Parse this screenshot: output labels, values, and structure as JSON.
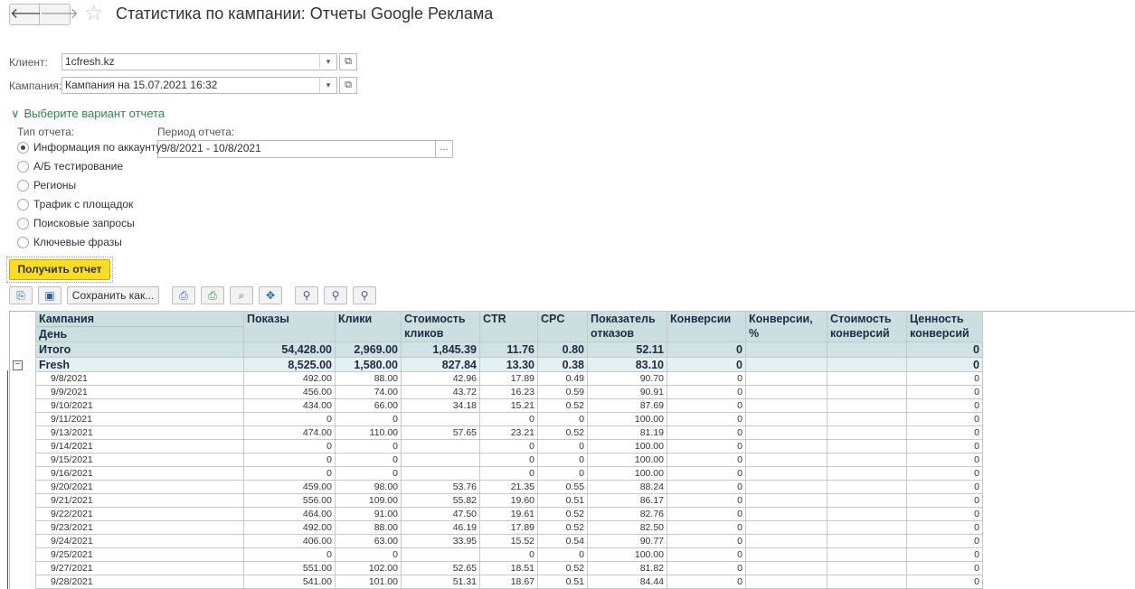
{
  "window": {
    "title": "Статистика по кампании: Отчеты Google Реклама",
    "back_glyph": "🡐",
    "forward_glyph": "🡒",
    "star_glyph": "☆"
  },
  "form": {
    "client_label": "Клиент:",
    "client_value": "1cfresh.kz",
    "campaign_label": "Кампания:",
    "campaign_value": "Кампания на 15.07.2021 16:32",
    "dropdown_glyph": "▾",
    "open_glyph": "⧉"
  },
  "report_group": {
    "title": "Выберите вариант отчета",
    "chevron": "∨",
    "type_label": "Тип отчета:",
    "period_label": "Период отчета:",
    "period_value": "9/8/2021 - 10/8/2021",
    "period_btn": "...",
    "options": [
      {
        "label": "Информация по аккаунту",
        "selected": true
      },
      {
        "label": "А/Б тестирование",
        "selected": false
      },
      {
        "label": "Регионы",
        "selected": false
      },
      {
        "label": "Трафик с площадок",
        "selected": false
      },
      {
        "label": "Поисковые запросы",
        "selected": false
      },
      {
        "label": "Ключевые фразы",
        "selected": false
      }
    ]
  },
  "get_report_label": "Получить отчет",
  "toolbar": {
    "save_as_label": "Сохранить как...",
    "icons": [
      "copy-icon",
      "save-icon",
      "print-icon",
      "print-preview-icon",
      "preview-icon",
      "move-icon",
      "search-icon",
      "find-next-icon",
      "find-prev-icon"
    ]
  },
  "table": {
    "headers": [
      {
        "top": "Кампания",
        "bottom": "День"
      },
      {
        "top": "Показы",
        "bottom": ""
      },
      {
        "top": "Клики",
        "bottom": ""
      },
      {
        "top": "Стоимость",
        "bottom": "кликов"
      },
      {
        "top": "CTR",
        "bottom": ""
      },
      {
        "top": "CPC",
        "bottom": ""
      },
      {
        "top": "Показатель",
        "bottom": "отказов"
      },
      {
        "top": "Конверсии",
        "bottom": ""
      },
      {
        "top": "Конверсии,",
        "bottom": "%"
      },
      {
        "top": "Стоимость",
        "bottom": "конверсий"
      },
      {
        "top": "Ценность",
        "bottom": "конверсий"
      }
    ],
    "total": [
      "Итого",
      "54,428.00",
      "2,969.00",
      "1,845.39",
      "11.76",
      "0.80",
      "52.11",
      "0",
      "",
      "",
      "0"
    ],
    "group": [
      "Fresh",
      "8,525.00",
      "1,580.00",
      "827.84",
      "13.30",
      "0.38",
      "83.10",
      "0",
      "",
      "",
      "0"
    ],
    "rows": [
      [
        "9/8/2021",
        "492.00",
        "88.00",
        "42.96",
        "17.89",
        "0.49",
        "90.70",
        "0",
        "",
        "",
        "0"
      ],
      [
        "9/9/2021",
        "456.00",
        "74.00",
        "43.72",
        "16.23",
        "0.59",
        "90.91",
        "0",
        "",
        "",
        "0"
      ],
      [
        "9/10/2021",
        "434.00",
        "66.00",
        "34.18",
        "15.21",
        "0.52",
        "87.69",
        "0",
        "",
        "",
        "0"
      ],
      [
        "9/11/2021",
        "0",
        "0",
        "",
        "0",
        "0",
        "100.00",
        "0",
        "",
        "",
        "0"
      ],
      [
        "9/13/2021",
        "474.00",
        "110.00",
        "57.65",
        "23.21",
        "0.52",
        "81.19",
        "0",
        "",
        "",
        "0"
      ],
      [
        "9/14/2021",
        "0",
        "0",
        "",
        "0",
        "0",
        "100.00",
        "0",
        "",
        "",
        "0"
      ],
      [
        "9/15/2021",
        "0",
        "0",
        "",
        "0",
        "0",
        "100.00",
        "0",
        "",
        "",
        "0"
      ],
      [
        "9/16/2021",
        "0",
        "0",
        "",
        "0",
        "0",
        "100.00",
        "0",
        "",
        "",
        "0"
      ],
      [
        "9/20/2021",
        "459.00",
        "98.00",
        "53.76",
        "21.35",
        "0.55",
        "88.24",
        "0",
        "",
        "",
        "0"
      ],
      [
        "9/21/2021",
        "556.00",
        "109.00",
        "55.82",
        "19.60",
        "0.51",
        "86.17",
        "0",
        "",
        "",
        "0"
      ],
      [
        "9/22/2021",
        "464.00",
        "91.00",
        "47.50",
        "19.61",
        "0.52",
        "82.76",
        "0",
        "",
        "",
        "0"
      ],
      [
        "9/23/2021",
        "492.00",
        "88.00",
        "46.19",
        "17.89",
        "0.52",
        "82.50",
        "0",
        "",
        "",
        "0"
      ],
      [
        "9/24/2021",
        "406.00",
        "63.00",
        "33.95",
        "15.52",
        "0.54",
        "90.77",
        "0",
        "",
        "",
        "0"
      ],
      [
        "9/25/2021",
        "0",
        "0",
        "",
        "0",
        "0",
        "100.00",
        "0",
        "",
        "",
        "0"
      ],
      [
        "9/27/2021",
        "551.00",
        "102.00",
        "52.65",
        "18.51",
        "0.52",
        "81.82",
        "0",
        "",
        "",
        "0"
      ],
      [
        "9/28/2021",
        "541.00",
        "101.00",
        "51.31",
        "18.67",
        "0.51",
        "84.44",
        "0",
        "",
        "",
        "0"
      ]
    ]
  }
}
